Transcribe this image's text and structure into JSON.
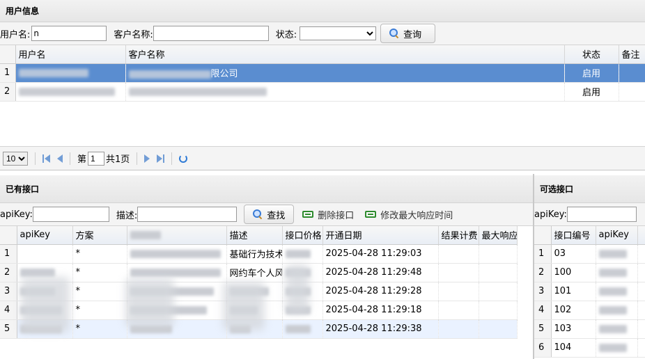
{
  "user_panel": {
    "title": "用户信息",
    "filters": {
      "username_label": "用户名:",
      "username_value": "n",
      "customer_label": "客户名称:",
      "customer_value": "",
      "status_label": "状态:",
      "status_value": "",
      "search_button": "查询"
    },
    "columns": [
      "用户名",
      "客户名称",
      "状态",
      "备注"
    ],
    "rows": [
      {
        "n": "1",
        "customer_suffix": "限公司",
        "status": "启用"
      },
      {
        "n": "2",
        "customer_suffix": "",
        "status": "启用"
      }
    ],
    "pager": {
      "page_size": "10",
      "page_prefix": "第",
      "page_value": "1",
      "page_total": "共1页"
    }
  },
  "api_panel": {
    "title": "已有接口",
    "filters": {
      "apikey_label": "apiKey:",
      "apikey_value": "",
      "desc_label": "描述:",
      "desc_value": "",
      "find_button": "查找",
      "delete_button": "删除接口",
      "modify_button": "修改最大响应时间"
    },
    "columns": [
      "apiKey",
      "方案",
      "",
      "描述",
      "接口价格",
      "开通日期",
      "结果计费",
      "最大响应"
    ],
    "rows": [
      {
        "n": "1",
        "plan": "*",
        "desc": "基础行为技术",
        "date": "2025-04-28 11:29:03"
      },
      {
        "n": "2",
        "plan": "*",
        "desc": "网约车个人风",
        "date": "2025-04-28 11:29:48"
      },
      {
        "n": "3",
        "plan": "*",
        "desc": "",
        "date": "2025-04-28 11:29:28"
      },
      {
        "n": "4",
        "plan": "*",
        "desc": "",
        "date": "2025-04-28 11:29:18"
      },
      {
        "n": "5",
        "plan": "*",
        "desc": "",
        "date": "2025-04-28 11:29:38"
      }
    ]
  },
  "optional_panel": {
    "title": "可选接口",
    "filters": {
      "apikey_label": "apiKey:",
      "apikey_value": ""
    },
    "columns": [
      "接口编号",
      "apiKey"
    ],
    "rows": [
      {
        "n": "1",
        "code": "03"
      },
      {
        "n": "2",
        "code": "100"
      },
      {
        "n": "3",
        "code": "101"
      },
      {
        "n": "4",
        "code": "102"
      },
      {
        "n": "5",
        "code": "103"
      },
      {
        "n": "6",
        "code": "104"
      }
    ]
  }
}
